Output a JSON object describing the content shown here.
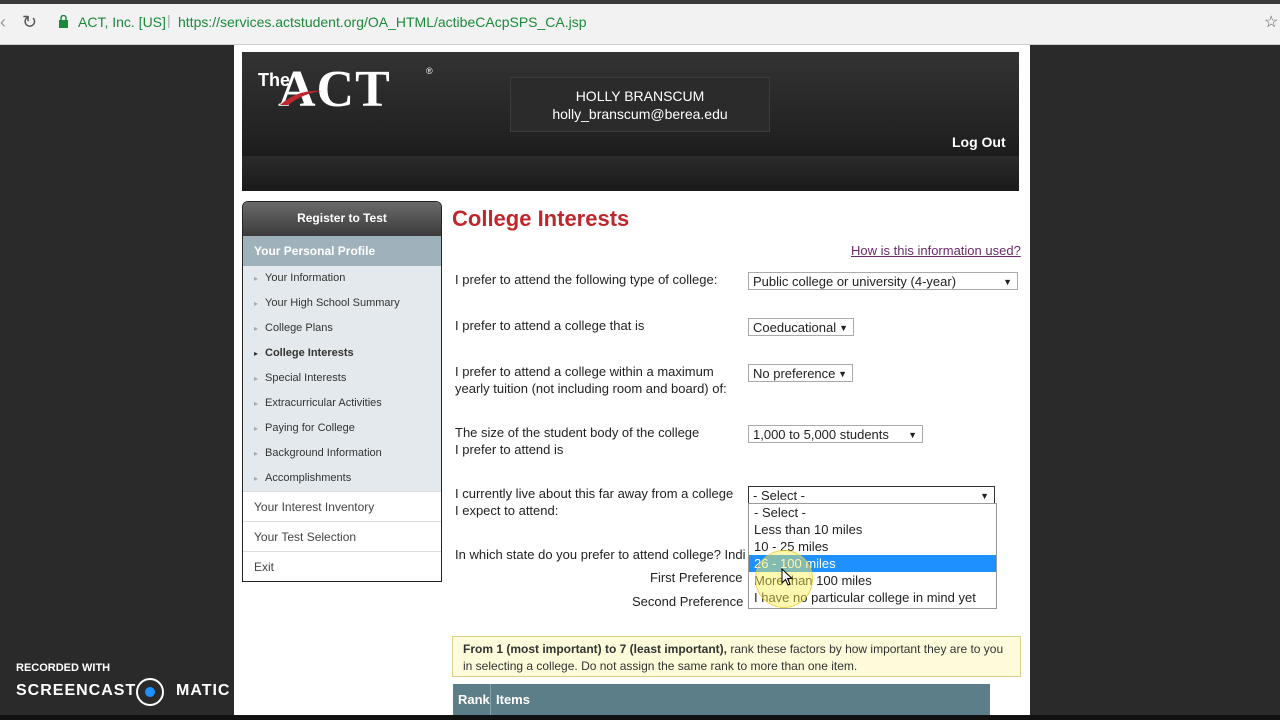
{
  "browser": {
    "site_identity": "ACT, Inc. [US]",
    "url": "https://services.actstudent.org/OA_HTML/actibeCAcpSPS_CA.jsp"
  },
  "header": {
    "logo_the": "The",
    "logo_act": "ACT",
    "logo_reg": "®",
    "user_name": "HOLLY BRANSCUM",
    "user_email": "holly_branscum@berea.edu",
    "logout": "Log Out"
  },
  "sidebar": {
    "register": "Register to Test",
    "profile": "Your Personal Profile",
    "items": [
      {
        "label": "Your Information",
        "active": false
      },
      {
        "label": "Your High School Summary",
        "active": false
      },
      {
        "label": "College Plans",
        "active": false
      },
      {
        "label": "College Interests",
        "active": true
      },
      {
        "label": "Special Interests",
        "active": false
      },
      {
        "label": "Extracurricular Activities",
        "active": false
      },
      {
        "label": "Paying for College",
        "active": false
      },
      {
        "label": "Background Information",
        "active": false
      },
      {
        "label": "Accomplishments",
        "active": false
      }
    ],
    "main_items": [
      "Your Interest Inventory",
      "Your Test Selection",
      "Exit"
    ]
  },
  "content": {
    "title": "College Interests",
    "how_link": "How is this information used?",
    "questions": [
      {
        "label": "I prefer to attend the following type of college:",
        "value": "Public college or university (4-year)"
      },
      {
        "label": "I prefer to attend a college that is",
        "value": "Coeducational"
      },
      {
        "label_line1": "I prefer to attend a college within a maximum",
        "label_line2": "yearly tuition (not including room and board) of:",
        "value": "No preference"
      },
      {
        "label_line1": "The size of the student body of the college",
        "label_line2": "I prefer to attend is",
        "value": "1,000 to 5,000 students"
      },
      {
        "label_line1": "I currently live about this far away from a college",
        "label_line2": "I expect to attend:",
        "value": "- Select -"
      }
    ],
    "state_question": "In which state do you prefer to attend college? Indi",
    "first_pref": "First Preference",
    "second_pref": "Second Preference",
    "dropdown_options": [
      {
        "label": "- Select -",
        "highlighted": false
      },
      {
        "label": "Less than 10 miles",
        "highlighted": false
      },
      {
        "label": "10 - 25 miles",
        "highlighted": false
      },
      {
        "label": "26 - 100 miles",
        "highlighted": true
      },
      {
        "label": "More than 100 miles",
        "highlighted": false
      },
      {
        "label": "I have no particular college in mind yet",
        "highlighted": false
      }
    ],
    "rank_bold": "From 1 (most important) to 7 (least important),",
    "rank_rest": " rank these factors by how important they are to you in selecting a college. Do not assign the same rank to more than one item.",
    "table_headers": [
      "Rank",
      "Items"
    ]
  },
  "watermark": {
    "recorded": "RECORDED WITH",
    "brand_left": "SCREENCAST",
    "brand_right": "MATIC"
  },
  "colors": {
    "title_red": "#c0272d",
    "sidebar_profile": "#9fb2bc",
    "highlight": "#1e90ff",
    "table_header": "#5c7e88"
  }
}
